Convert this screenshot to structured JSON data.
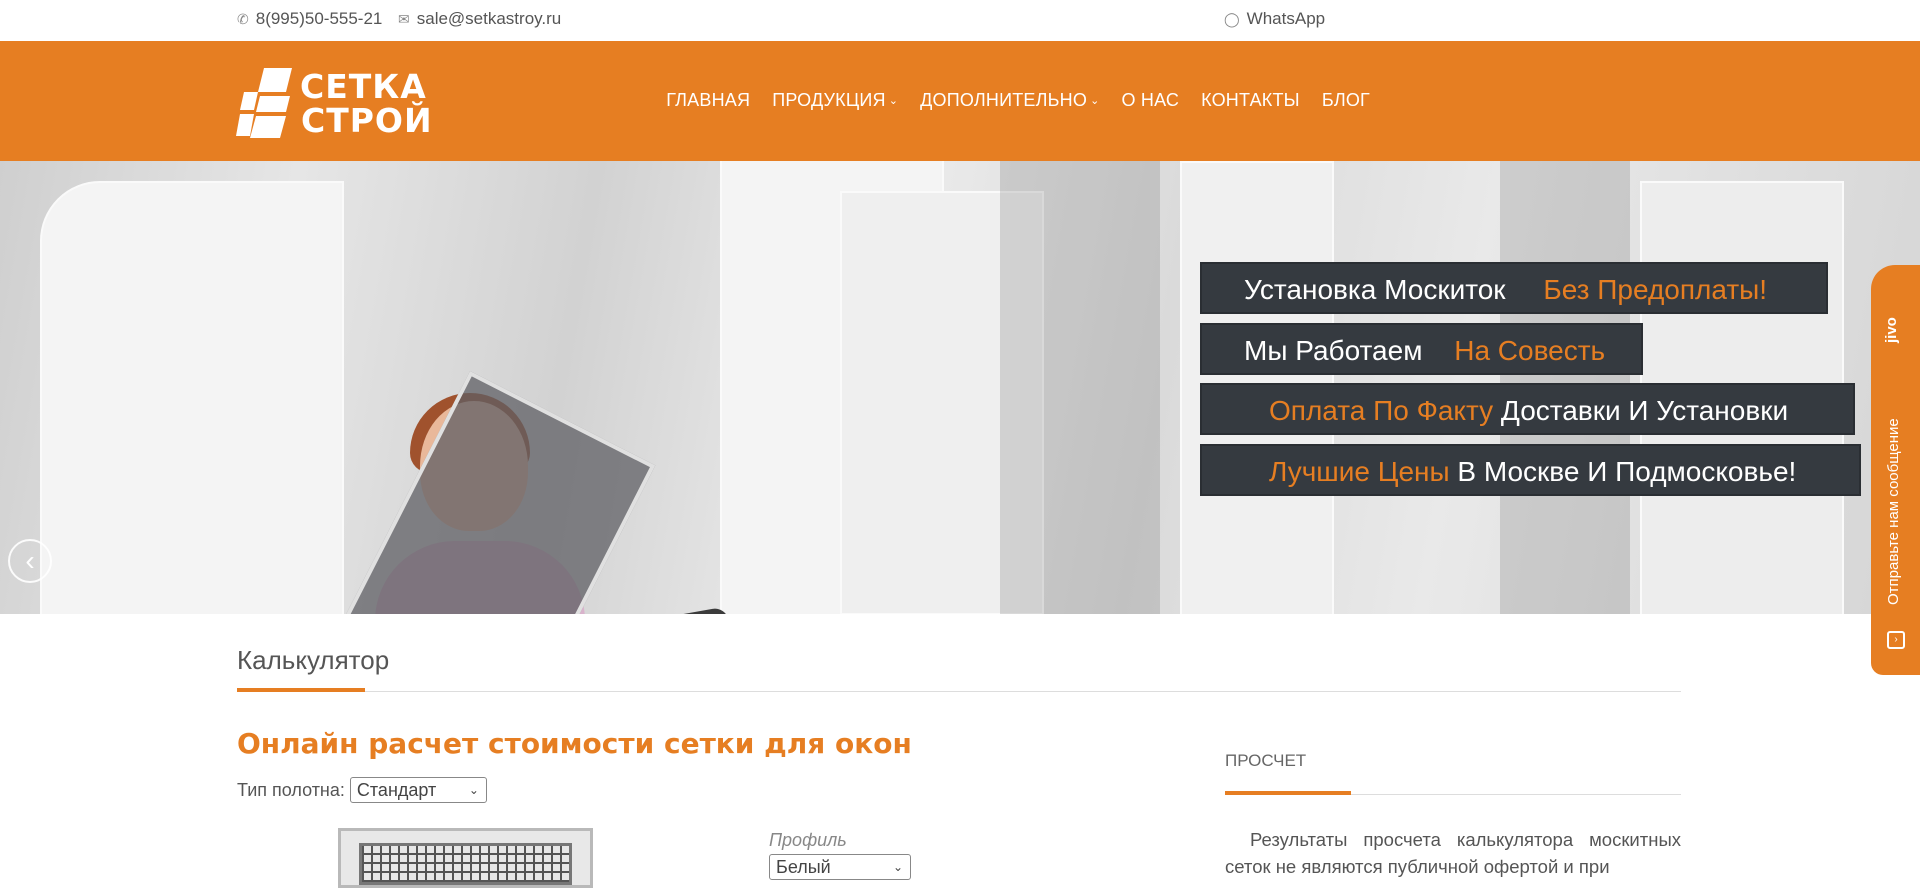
{
  "topbar": {
    "phone": "8(995)50-555-21",
    "email": "sale@setkastroy.ru",
    "whatsapp": "WhatsApp",
    "icons": [
      "phone-icon",
      "envelope-icon",
      "whatsapp-icon"
    ]
  },
  "header": {
    "logo_line1": "СЕТКА",
    "logo_line2": "СТРОЙ",
    "nav": [
      {
        "label": "ГЛАВНАЯ"
      },
      {
        "label": "ПРОДУКЦИЯ"
      },
      {
        "label": "ДОПОЛНИТЕЛЬНО"
      },
      {
        "label": "О НАС"
      },
      {
        "label": "КОНТАКТЫ"
      },
      {
        "label": "БЛОГ"
      }
    ],
    "accent_color": "#e67e22"
  },
  "hero": {
    "captions": [
      {
        "white": "Установка Москиток",
        "orange": "Без Предоплаты!"
      },
      {
        "white": "Мы Работаем",
        "orange": "На Совесть"
      },
      {
        "orange": "Оплата По Факту",
        "white": "Доставки И Установки"
      },
      {
        "orange": "Лучшие Цены",
        "white": "В Москве И Подмосковье!"
      }
    ]
  },
  "chat": {
    "brand": "jivo",
    "message": "Отправьте нам сообщение"
  },
  "content": {
    "tab_title": "Калькулятор",
    "calc_title": "Онлайн расчет стоимости сетки для окон",
    "type_label": "Тип полотна:",
    "type_value": "Стандарт",
    "profile_label": "Профиль",
    "profile_value": "Белый",
    "side_title": "ПРОСЧЕТ",
    "side_text": "Результаты просчета калькулятора москитных сеток не являются публичной офертой и при"
  }
}
